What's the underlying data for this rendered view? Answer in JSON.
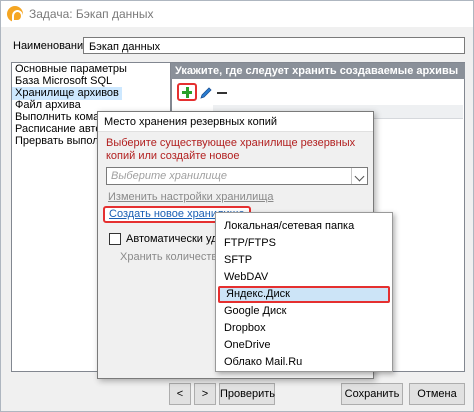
{
  "window": {
    "title": "Задача: Бэкап данных"
  },
  "name_field": {
    "label": "Наименование:",
    "value": "Бэкап данных"
  },
  "nav": {
    "items": [
      {
        "label": "Основные параметры",
        "selected": false
      },
      {
        "label": "База Microsoft SQL",
        "selected": false
      },
      {
        "label": "Хранилище архивов",
        "selected": true
      },
      {
        "label": "Файл архива",
        "selected": false
      },
      {
        "label": "Выполнить команд",
        "selected": false
      },
      {
        "label": "Расписание автоза",
        "selected": false
      },
      {
        "label": "Прервать выполне",
        "selected": false
      }
    ]
  },
  "storage_section": {
    "header": "Укажите, где следует хранить создаваемые архивы"
  },
  "dialog": {
    "title": "Место хранения резервных копий",
    "prompt": "Выберите существующее хранилище резервных копий или создайте новое",
    "combo_placeholder": "Выберите хранилище",
    "edit_link": "Изменить настройки хранилища",
    "create_link": "Создать новое хранилище",
    "auto_delete_label": "Автоматически удалят",
    "keep_count_label": "Хранить количество ко"
  },
  "storage_menu": {
    "items": [
      {
        "label": "Локальная/сетевая папка",
        "highlighted": false
      },
      {
        "label": "FTP/FTPS",
        "highlighted": false
      },
      {
        "label": "SFTP",
        "highlighted": false
      },
      {
        "label": "WebDAV",
        "highlighted": false
      },
      {
        "label": "Яндекс.Диск",
        "highlighted": true
      },
      {
        "label": "Google Диск",
        "highlighted": false
      },
      {
        "label": "Dropbox",
        "highlighted": false
      },
      {
        "label": "OneDrive",
        "highlighted": false
      },
      {
        "label": "Облако Mail.Ru",
        "highlighted": false
      }
    ]
  },
  "bottom_bar": {
    "prev_label": "<",
    "next_label": ">",
    "check_label": "Проверить",
    "save_label": "Сохранить",
    "cancel_label": "Отмена"
  },
  "colors": {
    "accent_outline": "#e53030",
    "link": "#1a5fb4",
    "section_header": "#8a9099",
    "selection": "#cde8ff"
  }
}
